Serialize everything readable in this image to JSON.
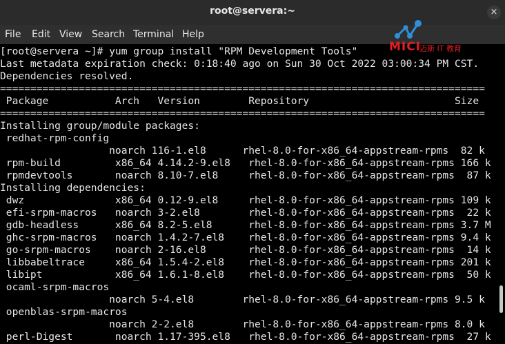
{
  "window": {
    "title": "root@servera:~",
    "close_glyph": "×"
  },
  "menu": [
    "File",
    "Edit",
    "View",
    "Search",
    "Terminal",
    "Help"
  ],
  "watermark": {
    "brand": "MICI",
    "sub": "迈斯 IT 教育"
  },
  "terminal": {
    "lines": [
      "[root@servera ~]# yum group install \"RPM Development Tools\"",
      "Last metadata expiration check: 0:18:40 ago on Sun 30 Oct 2022 03:00:34 PM CST.",
      "Dependencies resolved.",
      "================================================================================",
      " Package           Arch   Version        Repository                        Size",
      "================================================================================",
      "Installing group/module packages:",
      " redhat-rpm-config",
      "                  noarch 116-1.el8      rhel-8.0-for-x86_64-appstream-rpms  82 k",
      " rpm-build         x86_64 4.14.2-9.el8   rhel-8.0-for-x86_64-appstream-rpms 166 k",
      " rpmdevtools       noarch 8.10-7.el8     rhel-8.0-for-x86_64-appstream-rpms  87 k",
      "Installing dependencies:",
      " dwz               x86_64 0.12-9.el8     rhel-8.0-for-x86_64-appstream-rpms 109 k",
      " efi-srpm-macros   noarch 3-2.el8        rhel-8.0-for-x86_64-appstream-rpms  22 k",
      " gdb-headless      x86_64 8.2-5.el8      rhel-8.0-for-x86_64-appstream-rpms 3.7 M",
      " ghc-srpm-macros   noarch 1.4.2-7.el8    rhel-8.0-for-x86_64-appstream-rpms 9.4 k",
      " go-srpm-macros    noarch 2-16.el8       rhel-8.0-for-x86_64-appstream-rpms  14 k",
      " libbabeltrace     x86_64 1.5.4-2.el8    rhel-8.0-for-x86_64-appstream-rpms 201 k",
      " libipt            x86_64 1.6.1-8.el8    rhel-8.0-for-x86_64-appstream-rpms  50 k",
      " ocaml-srpm-macros",
      "                  noarch 5-4.el8        rhel-8.0-for-x86_64-appstream-rpms 9.5 k",
      " openblas-srpm-macros",
      "                  noarch 2-2.el8        rhel-8.0-for-x86_64-appstream-rpms 8.0 k",
      " perl-Digest       noarch 1.17-395.el8   rhel-8.0-for-x86_64-appstream-rpms  27 k"
    ]
  }
}
